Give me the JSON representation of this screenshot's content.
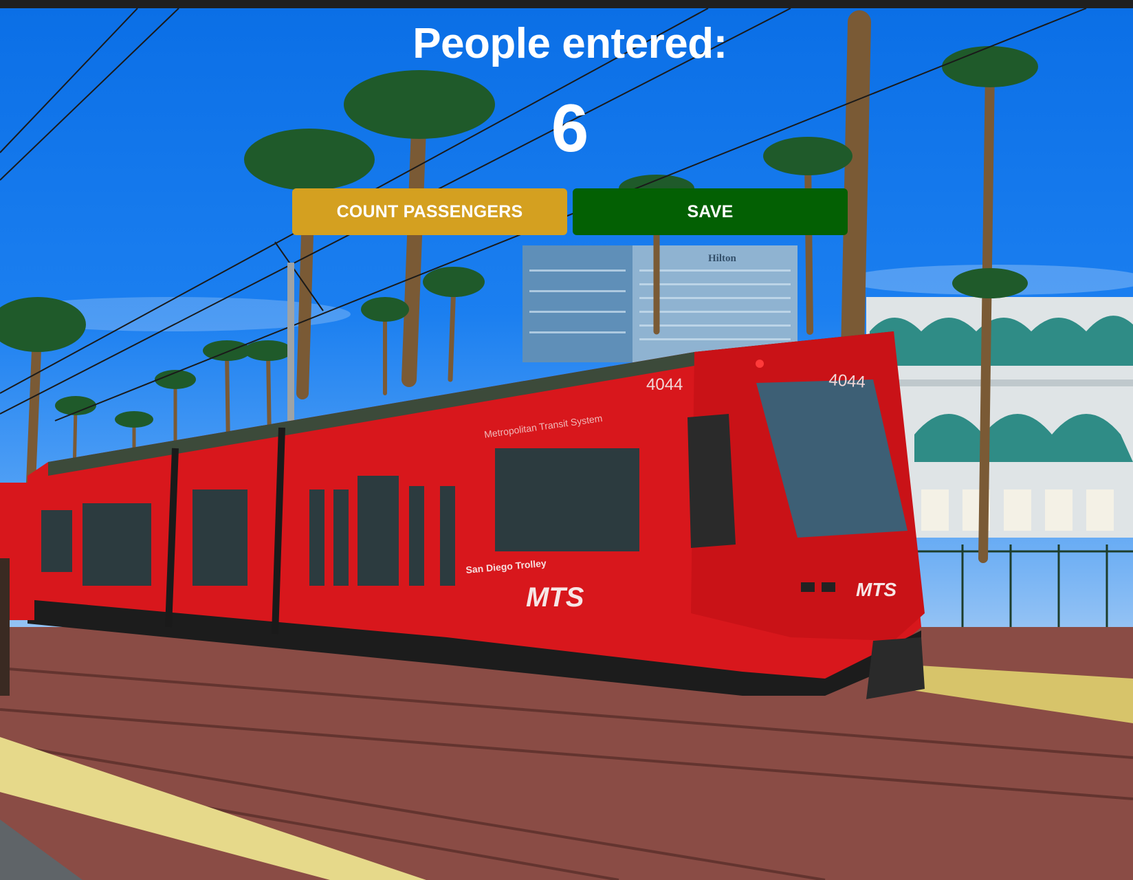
{
  "counter": {
    "label": "People entered:",
    "value": "6"
  },
  "buttons": {
    "count_label": "COUNT PASSENGERS",
    "save_label": "SAVE"
  },
  "photo": {
    "tram_number_side": "4044",
    "tram_number_front": "4044",
    "tram_text_upper": "Metropolitan Transit System",
    "tram_text_lower": "San Diego Trolley",
    "tram_logo": "MTS",
    "hotel_sign": "Hilton"
  },
  "colors": {
    "count_button": "#d4a020",
    "save_button": "#036003",
    "tram_red": "#d8171c",
    "sky_blue": "#0b6fe6"
  }
}
